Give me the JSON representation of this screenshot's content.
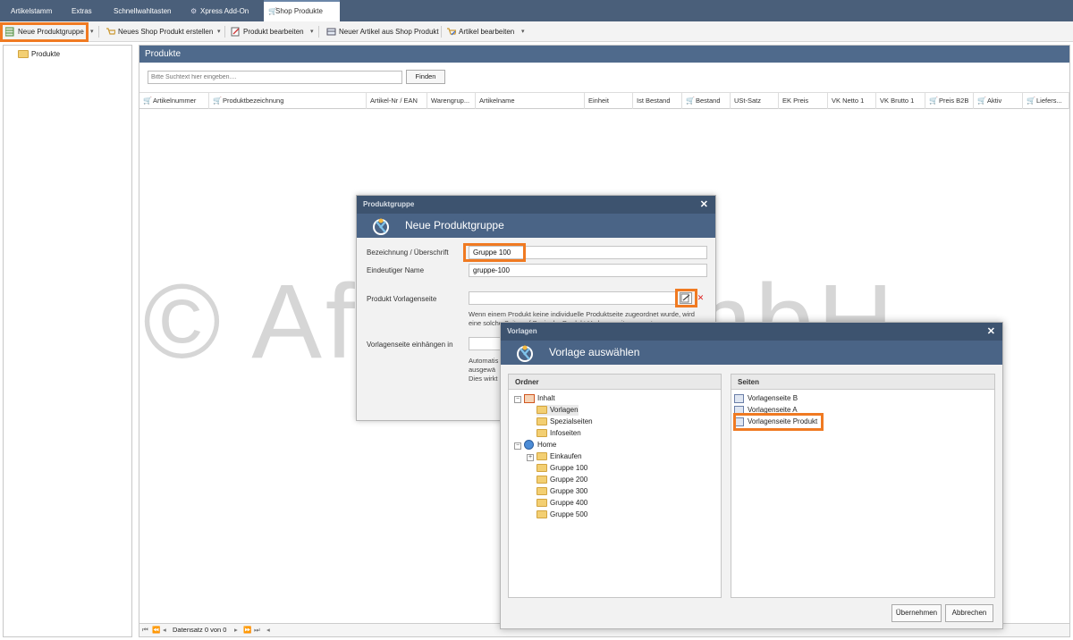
{
  "tabs": [
    "Artikelstamm",
    "Extras",
    "Schnellwahltasten",
    "Xpress Add-On",
    "Shop Produkte"
  ],
  "toolbar": {
    "neue_produktgruppe": "Neue Produktgruppe",
    "neues_shop_produkt": "Neues Shop Produkt erstellen",
    "produkt_bearbeiten": "Produkt bearbeiten",
    "neuer_artikel": "Neuer Artikel aus Shop Produkt",
    "artikel_bearbeiten": "Artikel bearbeiten"
  },
  "left_tree": {
    "root": "Produkte"
  },
  "main": {
    "title": "Produkte",
    "search_placeholder": "Bitte Suchtext hier eingeben....",
    "find_button": "Finden",
    "columns": [
      "Artikelnummer",
      "Produktbezeichnung",
      "Artikel-Nr / EAN",
      "Warengrup...",
      "Artikelname",
      "Einheit",
      "Ist Bestand",
      "Bestand",
      "USt-Satz",
      "EK Preis",
      "VK Netto 1",
      "VK Brutto 1",
      "Preis B2B",
      "Aktiv",
      "Liefers..."
    ],
    "record_status": "Datensatz 0 von 0"
  },
  "watermark": "© Afono GmbH",
  "dialog_produktgruppe": {
    "titlebar": "Produktgruppe",
    "header": "Neue Produktgruppe",
    "label_bezeichnung": "Bezeichnung / Überschrift",
    "value_bezeichnung": "Gruppe 100",
    "label_eindeutig": "Eindeutiger Name",
    "value_eindeutig": "gruppe-100",
    "label_vorlagenseite": "Produkt Vorlagenseite",
    "value_vorlagenseite": "",
    "note_line1": "Wenn einem Produkt keine individuelle Produktseite zugeordnet wurde, wird",
    "note_line2": "eine solche Seite auf Basis der Produkt-Vorlagenseite erzeugt.",
    "label_einhaengen": "Vorlagenseite einhängen in",
    "note2_line1": "Automatis",
    "note2_line2": "ausgewä",
    "note2_line3": "Dies wirkt"
  },
  "dialog_vorlagen": {
    "titlebar": "Vorlagen",
    "header": "Vorlage auswählen",
    "ordner_title": "Ordner",
    "seiten_title": "Seiten",
    "tree": {
      "inhalt": "Inhalt",
      "vorlagen": "Vorlagen",
      "spezialseiten": "Spezialseiten",
      "infoseiten": "Infoseiten",
      "home": "Home",
      "einkaufen": "Einkaufen",
      "gruppe100": "Gruppe 100",
      "gruppe200": "Gruppe 200",
      "gruppe300": "Gruppe 300",
      "gruppe400": "Gruppe 400",
      "gruppe500": "Gruppe 500"
    },
    "seiten": [
      "Vorlagenseite B",
      "Vorlagenseite A",
      "Vorlagenseite Produkt"
    ],
    "btn_uebernehmen": "Übernehmen",
    "btn_abbrechen": "Abbrechen"
  },
  "colors": {
    "accent": "#f07a22",
    "header_blue": "#4a6486",
    "titlebar": "#3d536f",
    "tabbar": "#4a5f7a"
  }
}
